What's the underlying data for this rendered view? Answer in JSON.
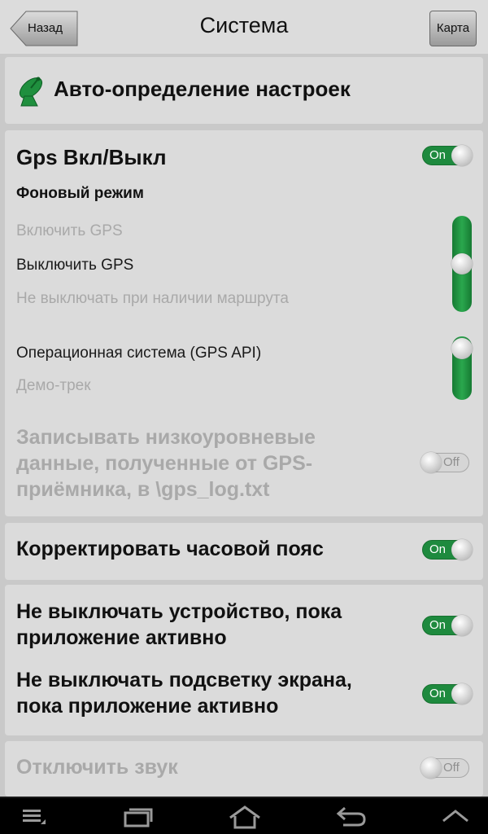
{
  "header": {
    "back_label": "Назад",
    "title": "Система",
    "map_label": "Карта"
  },
  "auto": {
    "label": "Авто-определение настроек",
    "icon": "satellite-dish-icon"
  },
  "gps": {
    "toggle_label": "Gps Вкл/Выкл",
    "toggle_state": "On",
    "background_mode_label": "Фоновый режим",
    "background_options": [
      "Включить GPS",
      "Выключить GPS",
      "Не выключать при наличии маршрута"
    ],
    "background_selected": 1,
    "source_options": [
      "Операционная система (GPS API)",
      "Демо-трек"
    ],
    "source_selected": 0,
    "log_label_lines": [
      "Записывать низкоуровневые",
      "данные, полученные от GPS-",
      "приёмника, в \\gps_log.txt"
    ],
    "log_state": "Off"
  },
  "timezone": {
    "label": "Корректировать часовой пояс",
    "state": "On"
  },
  "power": {
    "device_lines": [
      "Не выключать устройство, пока",
      "приложение активно"
    ],
    "device_state": "On",
    "backlight_lines": [
      "Не выключать подсветку экрана,",
      "пока приложение активно"
    ],
    "backlight_state": "On"
  },
  "sound": {
    "label": "Отключить звук",
    "state": "Off"
  },
  "navbar": {
    "icons": [
      "menu-icon",
      "recent-apps-icon",
      "home-icon",
      "back-icon",
      "chevron-up-icon"
    ]
  },
  "colors": {
    "accent_green": "#1e8a3e",
    "card_bg": "#dbdbdb",
    "page_bg": "#c9c9c9"
  }
}
